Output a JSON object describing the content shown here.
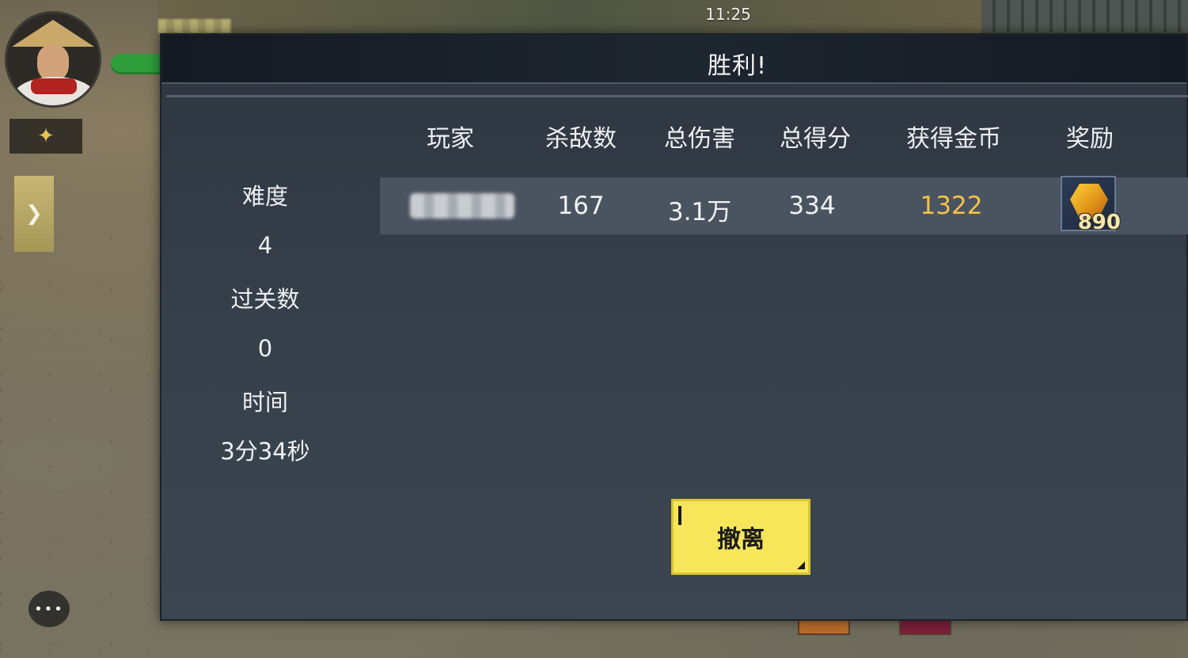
{
  "status_bar": {
    "time": "11:25"
  },
  "hud": {
    "skill_icon": "✦",
    "side_tab_icon": "❯",
    "chat_icon": "•••"
  },
  "panel": {
    "title": "胜利!",
    "summary": {
      "difficulty_label": "难度",
      "difficulty_value": "4",
      "stages_label": "过关数",
      "stages_value": "0",
      "time_label": "时间",
      "time_value": "3分34秒"
    },
    "table": {
      "headers": [
        "玩家",
        "杀敌数",
        "总伤害",
        "总得分",
        "获得金币",
        "奖励"
      ],
      "rows": [
        {
          "kills": "167",
          "damage": "3.1万",
          "score": "334",
          "gold": "1322",
          "reward_count": "890"
        }
      ]
    },
    "retreat_button": "撤离"
  },
  "colors": {
    "accent_gold": "#f2c24b",
    "button_yellow": "#f7e65a",
    "hp_green": "#2e9e3a"
  }
}
